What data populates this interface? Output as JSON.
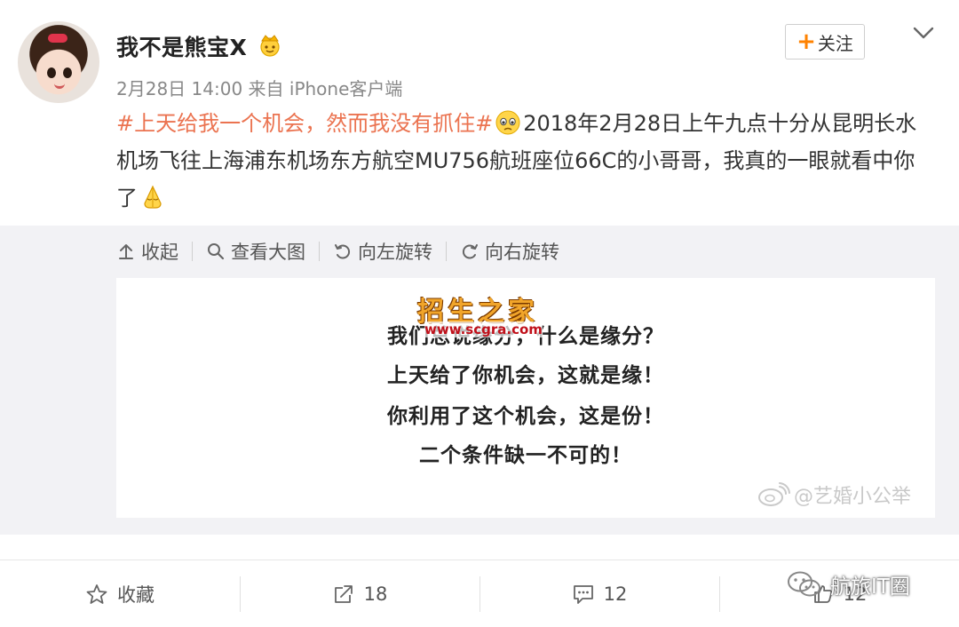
{
  "post": {
    "username": "我不是熊宝X",
    "meta": "2月28日 14:00 来自 iPhone客户端",
    "follow_label": "关注",
    "text": {
      "hashtag": "#上天给我一个机会，然而我没有抓住#",
      "body": "2018年2月28日上午九点十分从昆明长水机场飞往上海浦东机场东方航空MU756航班座位66C的小哥哥，我真的一眼就看中你了"
    }
  },
  "media": {
    "toolbar": {
      "collapse": "收起",
      "view_large": "查看大图",
      "rotate_left": "向左旋转",
      "rotate_right": "向右旋转"
    },
    "image_lines": [
      "我们总说缘分，什么是缘分？",
      "上天给了你机会，这就是缘！",
      "你利用了这个机会，这是份！",
      "二个条件缺一不可的！"
    ],
    "watermark_title": "招生之家",
    "watermark_url": "www.scgra.com",
    "weibo_watermark": "@艺婚小公举"
  },
  "actions": {
    "favorite": "收藏",
    "repost": "18",
    "comment": "12",
    "like": "12"
  },
  "overlay_watermark": "航旅IT圈",
  "colors": {
    "hashtag": "#eb7350",
    "follow_plus": "#ff8200",
    "panel_bg": "#f2f2f5"
  },
  "icons": [
    "crown-icon",
    "chevron-down-icon",
    "collapse-icon",
    "search-icon",
    "rotate-left-icon",
    "rotate-right-icon",
    "star-icon",
    "repost-icon",
    "comment-icon",
    "wechat-icon",
    "weibo-logo-icon",
    "pensive-emoji",
    "pray-emoji"
  ]
}
